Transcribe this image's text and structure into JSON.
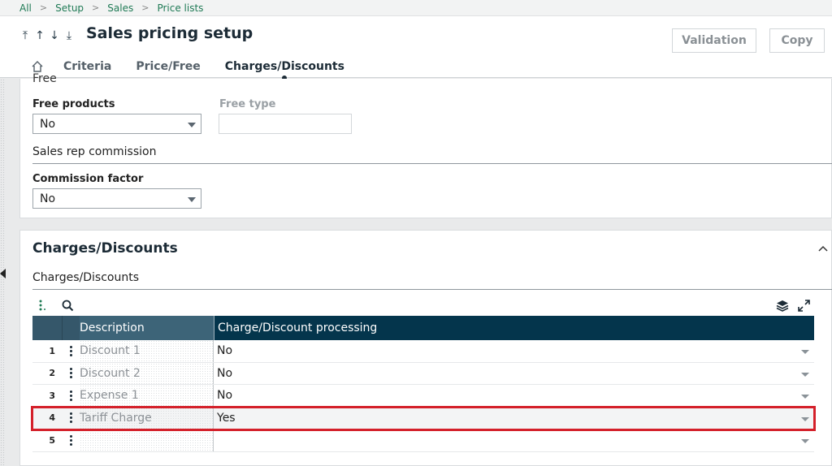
{
  "breadcrumb": [
    "All",
    "Setup",
    "Sales",
    "Price lists"
  ],
  "header": {
    "title": "Sales pricing setup",
    "validation_label": "Validation",
    "copy_label": "Copy"
  },
  "tabs": [
    "Criteria",
    "Price/Free",
    "Charges/Discounts"
  ],
  "free_section": {
    "cut_label": "Free",
    "free_products_label": "Free products",
    "free_products_value": "No",
    "free_type_label": "Free type",
    "free_type_value": ""
  },
  "commission_section": {
    "title": "Sales rep commission",
    "factor_label": "Commission factor",
    "factor_value": "No"
  },
  "charges": {
    "card_title": "Charges/Discounts",
    "subtitle": "Charges/Discounts",
    "columns": [
      "Description",
      "Charge/Discount processing"
    ],
    "rows": [
      {
        "num": "1",
        "description": "Discount 1",
        "processing": "No"
      },
      {
        "num": "2",
        "description": "Discount 2",
        "processing": "No"
      },
      {
        "num": "3",
        "description": "Expense 1",
        "processing": "No"
      },
      {
        "num": "4",
        "description": "Tariff Charge",
        "processing": "Yes"
      },
      {
        "num": "5",
        "description": "",
        "processing": ""
      }
    ]
  },
  "colors": {
    "accent_green": "#1f7a55",
    "grid_header_dark": "#04354c",
    "highlight_red": "#d4202a"
  }
}
